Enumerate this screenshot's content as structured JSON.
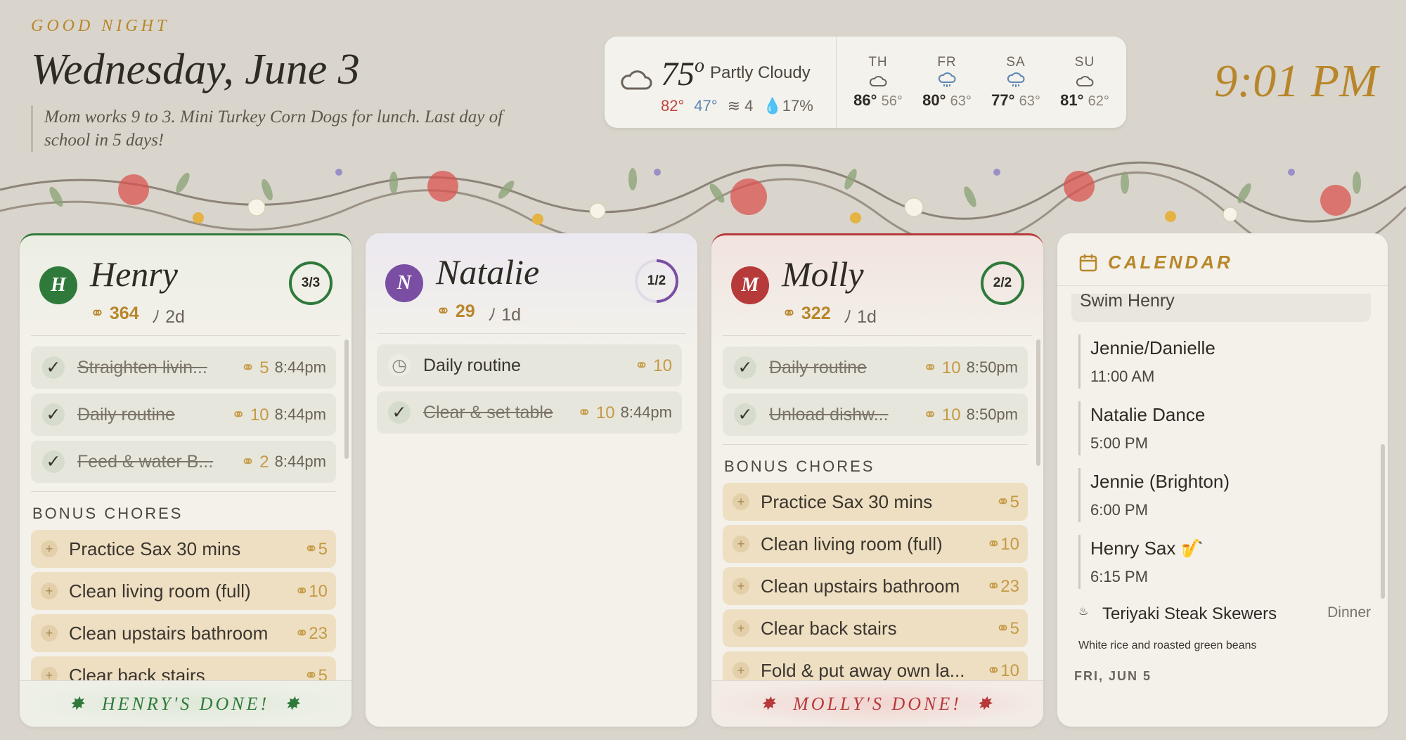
{
  "header": {
    "greeting": "GOOD NIGHT",
    "date": "Wednesday, June 3",
    "note": "Mom works 9 to 3. Mini Turkey Corn Dogs for lunch. Last day of school in 5 days!",
    "time": "9:01 PM"
  },
  "weather": {
    "current_temp": "75",
    "degree": "o",
    "condition": "Partly Cloudy",
    "high": "82°",
    "low": "47°",
    "wind": "4",
    "precip": "17%",
    "forecast": [
      {
        "day": "TH",
        "icon": "cloud-icon",
        "high": "86°",
        "low": "56°"
      },
      {
        "day": "FR",
        "icon": "rain-cloud-icon",
        "high": "80°",
        "low": "63°"
      },
      {
        "day": "SA",
        "icon": "rain-cloud-icon",
        "high": "77°",
        "low": "63°"
      },
      {
        "day": "SU",
        "icon": "cloud-icon",
        "high": "81°",
        "low": "62°"
      }
    ]
  },
  "bonus_header": "BONUS CHORES",
  "kids": [
    {
      "initial": "H",
      "name": "Henry",
      "coins": "364",
      "streak": "2d",
      "progress": "3/3",
      "progress_value": 1.0,
      "color": "#2f7a3b",
      "chores": [
        {
          "label": "Straighten livin...",
          "points": "5",
          "time": "8:44pm"
        },
        {
          "label": "Daily routine",
          "points": "10",
          "time": "8:44pm"
        },
        {
          "label": "Feed & water B...",
          "points": "2",
          "time": "8:44pm"
        }
      ],
      "bonus": [
        {
          "label": "Practice Sax 30 mins",
          "points": "5"
        },
        {
          "label": "Clean living room (full)",
          "points": "10"
        },
        {
          "label": "Clean upstairs bathroom",
          "points": "23"
        },
        {
          "label": "Clear back stairs",
          "points": "5"
        }
      ],
      "done_text": "HENRY'S DONE!"
    },
    {
      "initial": "N",
      "name": "Natalie",
      "coins": "29",
      "streak": "1d",
      "progress": "1/2",
      "progress_value": 0.5,
      "color": "#7a4fa3",
      "chores": [
        {
          "label": "Daily routine",
          "points": "10",
          "time": ""
        },
        {
          "label": "Clear & set table",
          "points": "10",
          "time": "8:44pm"
        }
      ]
    },
    {
      "initial": "M",
      "name": "Molly",
      "coins": "322",
      "streak": "1d",
      "progress": "2/2",
      "progress_value": 1.0,
      "color": "#b63a3a",
      "chores": [
        {
          "label": "Daily routine",
          "points": "10",
          "time": "8:50pm"
        },
        {
          "label": "Unload dishw...",
          "points": "10",
          "time": "8:50pm"
        }
      ],
      "bonus": [
        {
          "label": "Practice Sax 30 mins",
          "points": "5"
        },
        {
          "label": "Clean living room (full)",
          "points": "10"
        },
        {
          "label": "Clean upstairs bathroom",
          "points": "23"
        },
        {
          "label": "Clear back stairs",
          "points": "5"
        },
        {
          "label": "Fold & put away own la...",
          "points": "10"
        }
      ],
      "done_text": "MOLLY'S DONE!"
    }
  ],
  "calendar": {
    "title": "CALENDAR",
    "partial_event": "Swim Henry",
    "events": [
      {
        "title": "Jennie/Danielle",
        "time": "11:00 AM"
      },
      {
        "title": "Natalie Dance",
        "time": "5:00 PM"
      },
      {
        "title": "Jennie (Brighton)",
        "time": "6:00 PM"
      },
      {
        "title": "Henry Sax 🎷",
        "time": "6:15 PM"
      }
    ],
    "meal": {
      "title": "Teriyaki Steak Skewers",
      "kind": "Dinner",
      "desc": "White rice and roasted green beans"
    },
    "next_day": "FRI, JUN 5"
  }
}
